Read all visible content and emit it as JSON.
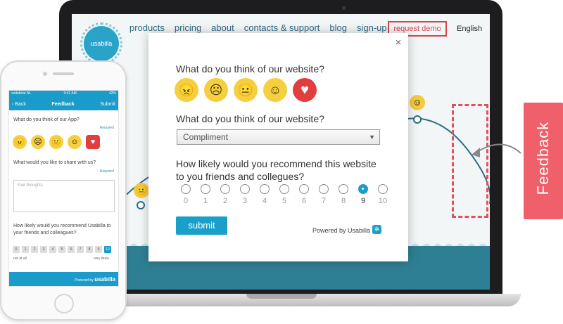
{
  "website": {
    "logo_text": "usabilla",
    "nav": [
      "products",
      "pricing",
      "about",
      "contacts & support",
      "blog",
      "sign-up"
    ],
    "request_button": "request demo",
    "language": "English"
  },
  "feedback_tab": {
    "label": "Feedback"
  },
  "modal": {
    "close": "×",
    "question_mood": "What do you think of our website?",
    "moods": [
      {
        "name": "angry",
        "glyph": "😠"
      },
      {
        "name": "sad",
        "glyph": "☹"
      },
      {
        "name": "neutral",
        "glyph": "😐"
      },
      {
        "name": "happy",
        "glyph": "☺"
      },
      {
        "name": "love",
        "glyph": "♥"
      }
    ],
    "question_type": "What do you think of our website?",
    "type_selected": "Compliment",
    "question_nps": "How likely would you recommend this website to you friends and collegues?",
    "nps_scale": [
      "0",
      "1",
      "2",
      "3",
      "4",
      "5",
      "6",
      "7",
      "8",
      "9",
      "10"
    ],
    "nps_selected": "9",
    "submit_label": "submit",
    "powered_by": "Powered by Usabilla"
  },
  "phone": {
    "status_carrier": "vodafone NL",
    "status_time": "9:41 AM",
    "status_battery": "42%",
    "back_label": "Back",
    "title": "Feedback",
    "submit_label": "Submit",
    "question_mood": "What do you think of our App?",
    "required_label": "Required",
    "question_share": "What would you like to share with us?",
    "textarea_placeholder": "Your thoughts",
    "question_nps": "How likely would you recommend Usabilla to your friends and colleagues?",
    "nps_scale": [
      "0",
      "1",
      "2",
      "3",
      "4",
      "5",
      "6",
      "7",
      "8",
      "9",
      "10"
    ],
    "nps_selected": "10",
    "nps_low": "not at all",
    "nps_high": "very likely",
    "footer_powered": "Powered by",
    "footer_brand": "usabilla"
  },
  "colors": {
    "accent": "#1aa0c8",
    "feedback_tab": "#f0606a",
    "emoji": "#f6cf3f",
    "heart": "#e23d3f"
  }
}
